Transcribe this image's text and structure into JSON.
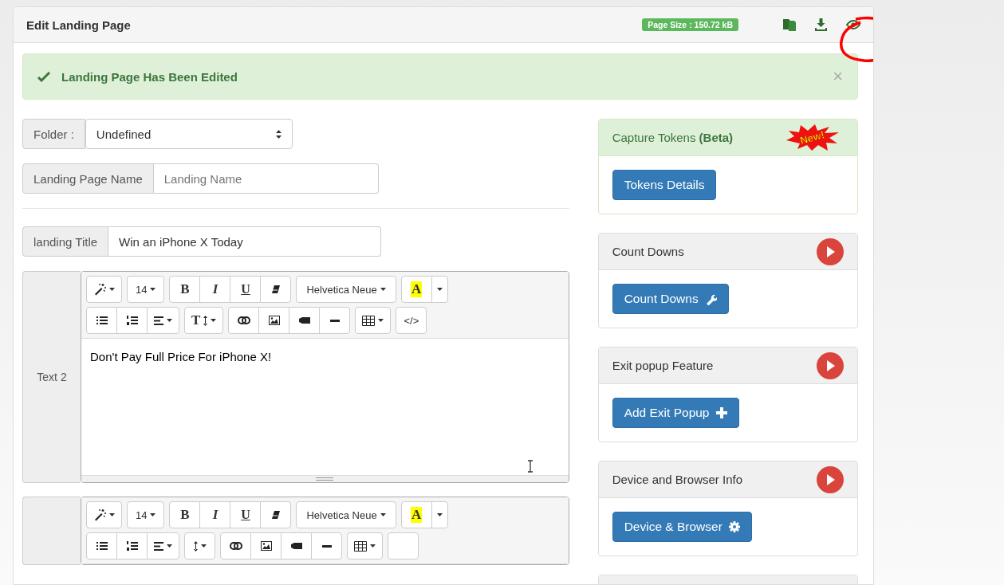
{
  "panel": {
    "title": "Edit Landing Page",
    "page_size": "Page Size : 150.72 kB"
  },
  "alert": {
    "message": "Landing Page Has Been Edited",
    "close": "×"
  },
  "form": {
    "folder": {
      "label": "Folder :",
      "value": "Undefined"
    },
    "name": {
      "label": "Landing Page Name",
      "placeholder": "Landing Name"
    },
    "title": {
      "label": "landing Title",
      "value": "Win an iPhone X Today"
    }
  },
  "editors": [
    {
      "label": "Text 2",
      "content": "Don't Pay Full Price For iPhone X!",
      "toolbar": [
        {
          "groups": [
            {
              "buttons": [
                {
                  "kind": "style"
                }
              ]
            },
            {
              "buttons": [
                {
                  "kind": "fontsize",
                  "label": "14"
                }
              ]
            },
            {
              "buttons": [
                {
                  "kind": "bold",
                  "label": "B"
                },
                {
                  "kind": "italic",
                  "label": "I"
                },
                {
                  "kind": "underline",
                  "label": "U"
                },
                {
                  "kind": "clear"
                }
              ]
            },
            {
              "buttons": [
                {
                  "kind": "fontname",
                  "label": "Helvetica Neue"
                }
              ]
            },
            {
              "buttons": [
                {
                  "kind": "color",
                  "label": "A"
                },
                {
                  "kind": "colormenu"
                }
              ]
            }
          ]
        },
        {
          "groups": [
            {
              "buttons": [
                {
                  "kind": "ul"
                },
                {
                  "kind": "ol"
                },
                {
                  "kind": "align"
                }
              ]
            },
            {
              "buttons": [
                {
                  "kind": "height",
                  "label": "T"
                }
              ]
            },
            {
              "buttons": [
                {
                  "kind": "link"
                },
                {
                  "kind": "image"
                },
                {
                  "kind": "video"
                },
                {
                  "kind": "hr"
                }
              ]
            },
            {
              "buttons": [
                {
                  "kind": "table"
                }
              ]
            },
            {
              "buttons": [
                {
                  "kind": "code",
                  "label": "</>"
                }
              ]
            }
          ]
        }
      ]
    },
    {
      "toolbar": [
        {
          "groups": [
            {
              "buttons": [
                {
                  "kind": "style"
                }
              ]
            },
            {
              "buttons": [
                {
                  "kind": "fontsize",
                  "label": "14"
                }
              ]
            },
            {
              "buttons": [
                {
                  "kind": "bold",
                  "label": "B"
                },
                {
                  "kind": "italic",
                  "label": "I"
                },
                {
                  "kind": "underline",
                  "label": "U"
                },
                {
                  "kind": "clear"
                }
              ]
            },
            {
              "buttons": [
                {
                  "kind": "fontname",
                  "label": "Helvetica Neue"
                }
              ]
            },
            {
              "buttons": [
                {
                  "kind": "color",
                  "label": "A"
                },
                {
                  "kind": "colormenu"
                }
              ]
            }
          ]
        },
        {
          "groups": [
            {
              "buttons": [
                {
                  "kind": "ul"
                },
                {
                  "kind": "ol"
                },
                {
                  "kind": "align"
                }
              ]
            },
            {
              "buttons": [
                {
                  "kind": "height"
                }
              ]
            },
            {
              "buttons": [
                {
                  "kind": "link"
                },
                {
                  "kind": "image"
                },
                {
                  "kind": "video"
                },
                {
                  "kind": "hr"
                }
              ]
            },
            {
              "buttons": [
                {
                  "kind": "table"
                }
              ]
            },
            {
              "buttons": [
                {
                  "kind": "code"
                }
              ]
            }
          ]
        }
      ]
    }
  ],
  "cards": [
    {
      "kind": "new",
      "title": "Capture Tokens **(Beta)**",
      "badge": "New!",
      "button": "Tokens Details"
    },
    {
      "kind": "video",
      "title": "Count Downs",
      "button": "Count Downs"
    },
    {
      "kind": "video",
      "title": "Exit popup Feature",
      "button": "Add Exit Popup"
    },
    {
      "kind": "video",
      "title": "Device and Browser Info",
      "button": "Device & Browser"
    },
    {
      "kind": "empty"
    }
  ]
}
